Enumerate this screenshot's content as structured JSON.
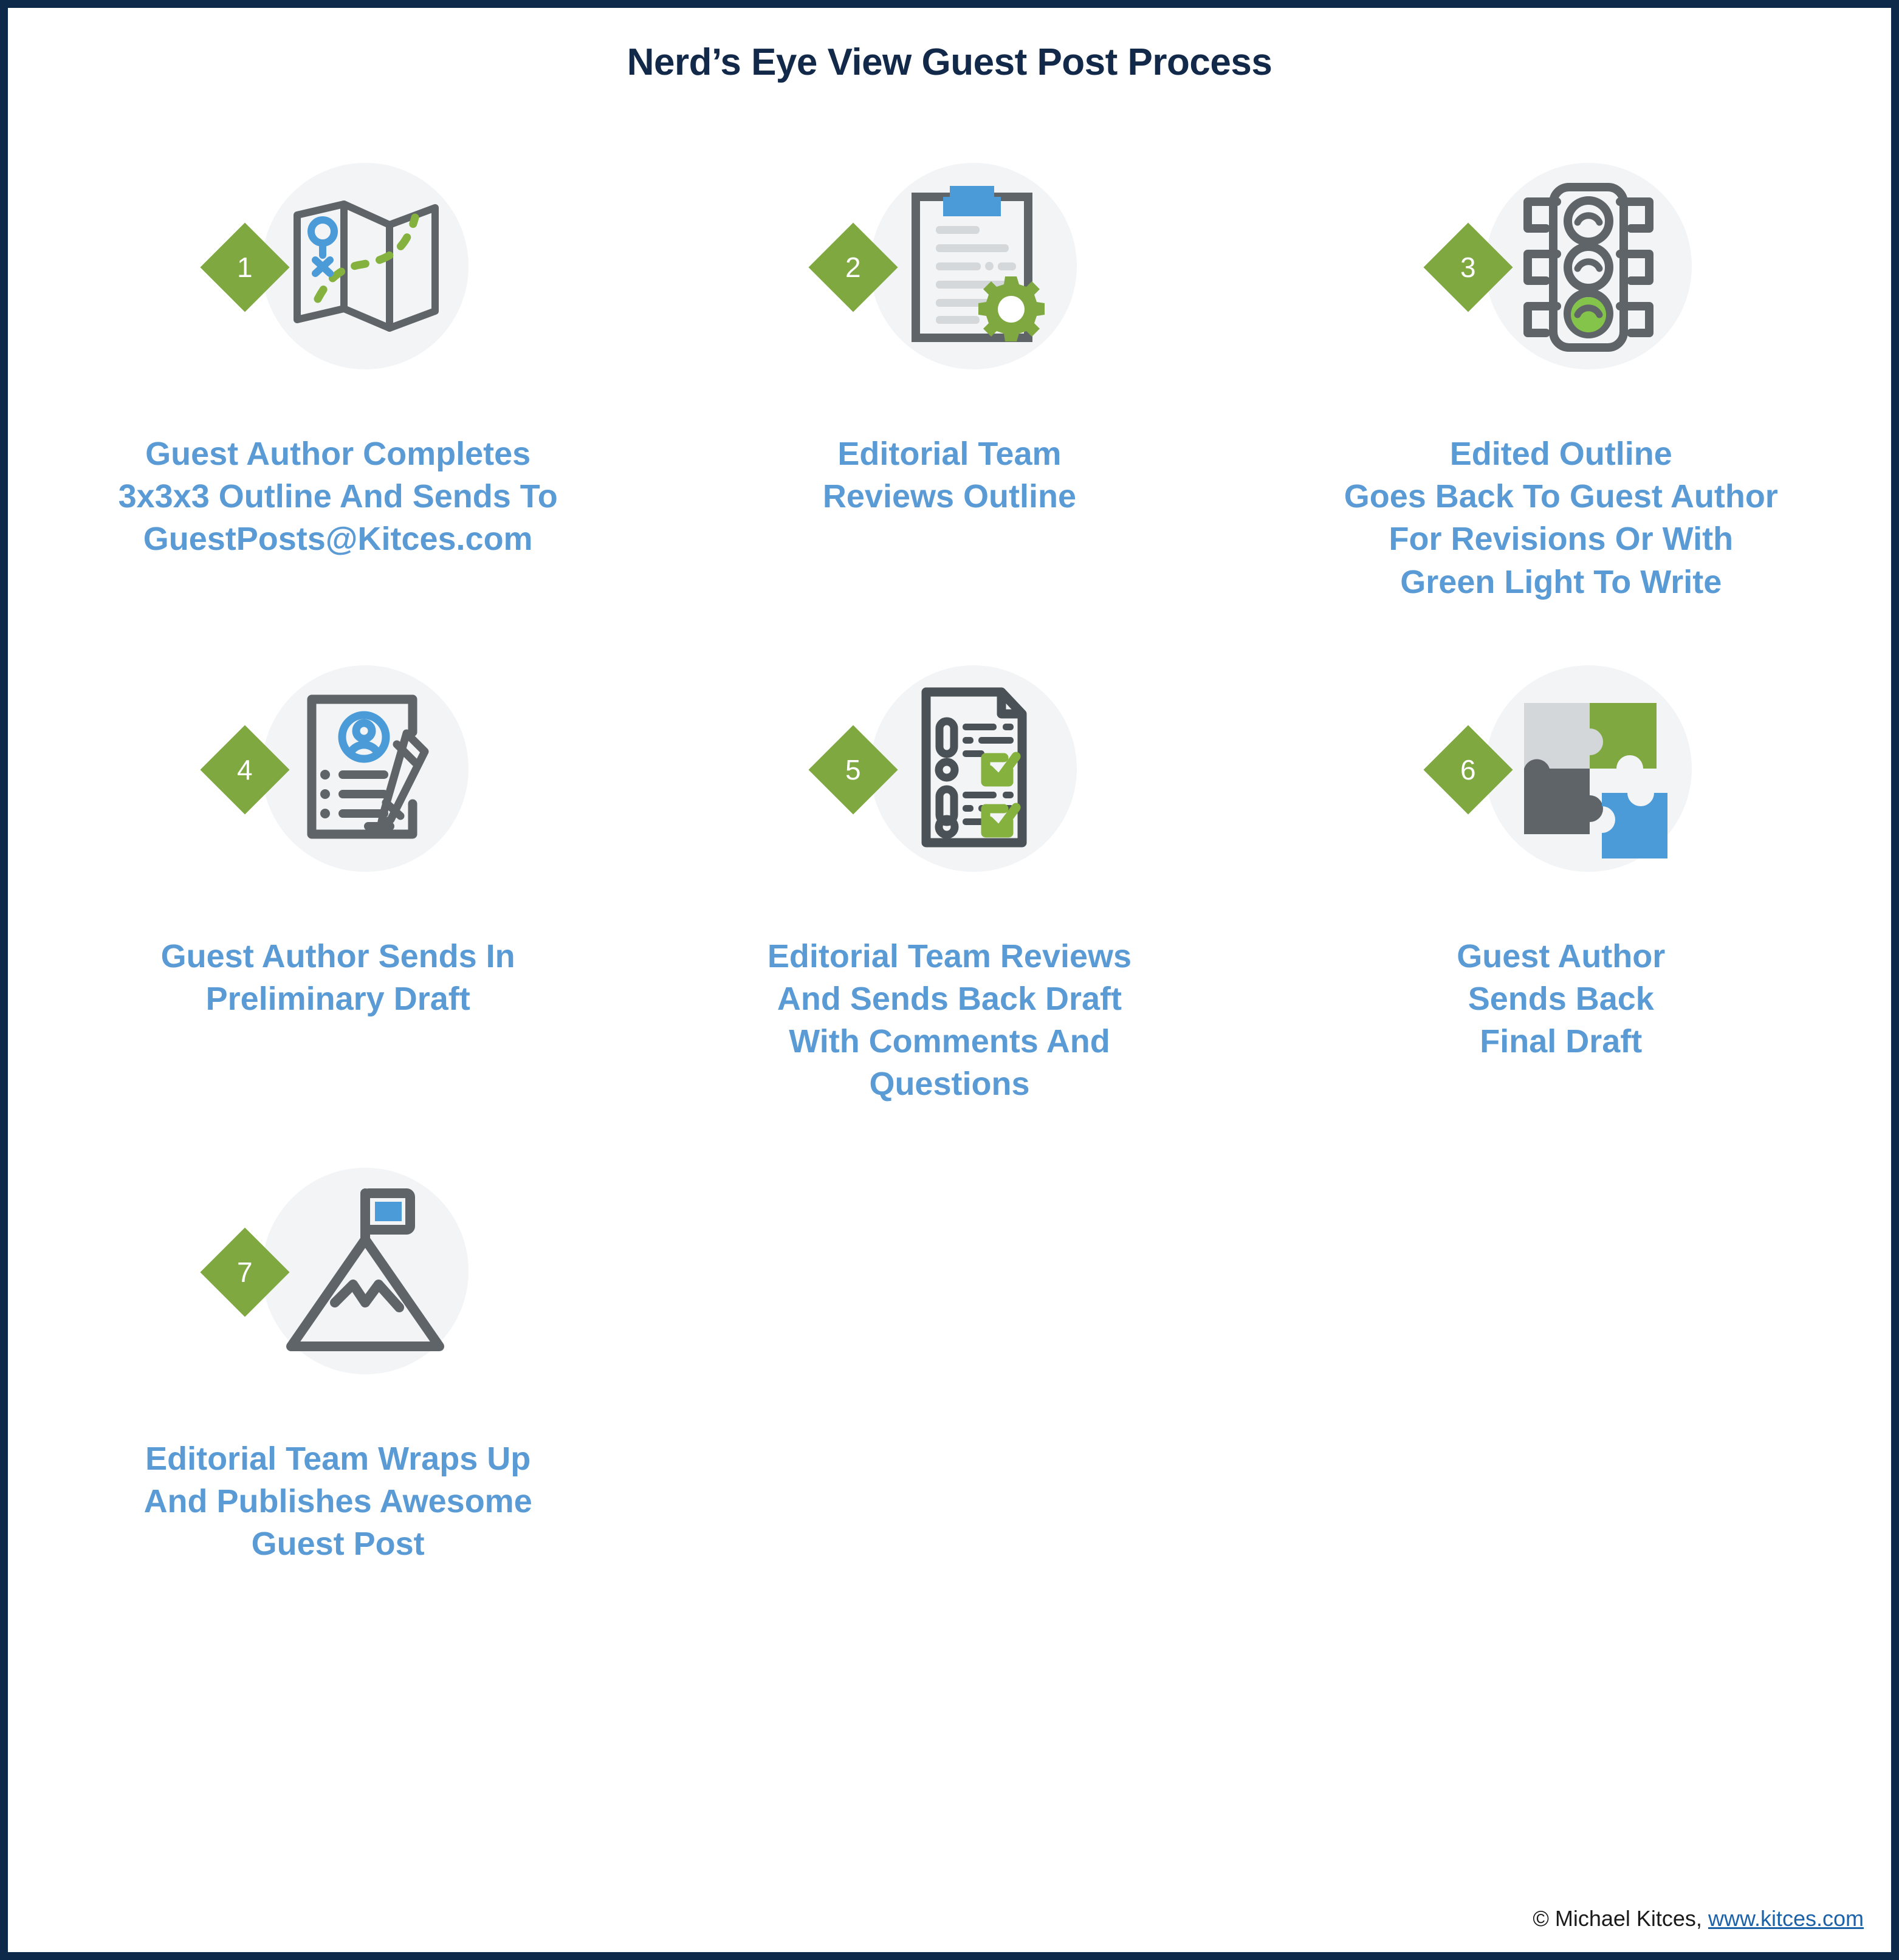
{
  "header": {
    "title": "Nerd’s Eye View Guest Post Process"
  },
  "theme": {
    "border_navy": "#0d2a4b",
    "title_navy": "#12294a",
    "caption_blue": "#5a9bd5",
    "badge_green": "#7fa841",
    "icon_gray": "#5f6468",
    "disc_gray": "#f2f4f6",
    "accent_blue": "#4a9bd8",
    "link_blue": "#1b62a8"
  },
  "steps": [
    {
      "number": "1",
      "icon": "folded-map-icon",
      "lines": [
        "Guest Author Completes",
        "3x3x3 Outline And Sends To",
        "GuestPosts@Kitces.com"
      ]
    },
    {
      "number": "2",
      "icon": "clipboard-gear-icon",
      "lines": [
        "Editorial Team",
        "Reviews Outline"
      ]
    },
    {
      "number": "3",
      "icon": "traffic-light-icon",
      "lines": [
        "Edited Outline",
        "Goes Back To Guest Author",
        "For Revisions Or With",
        "Green Light To Write"
      ]
    },
    {
      "number": "4",
      "icon": "document-pencil-icon",
      "lines": [
        "Guest Author Sends In",
        "Preliminary Draft"
      ]
    },
    {
      "number": "5",
      "icon": "checklist-document-icon",
      "lines": [
        "Editorial Team Reviews",
        "And Sends Back Draft",
        "With Comments And",
        "Questions"
      ]
    },
    {
      "number": "6",
      "icon": "puzzle-pieces-icon",
      "lines": [
        "Guest Author",
        "Sends Back",
        "Final Draft"
      ]
    },
    {
      "number": "7",
      "icon": "mountain-flag-icon",
      "lines": [
        "Editorial Team Wraps Up",
        "And Publishes Awesome",
        "Guest Post"
      ]
    }
  ],
  "footer": {
    "copyright": "© Michael Kitces,",
    "link": "www.kitces.com"
  }
}
